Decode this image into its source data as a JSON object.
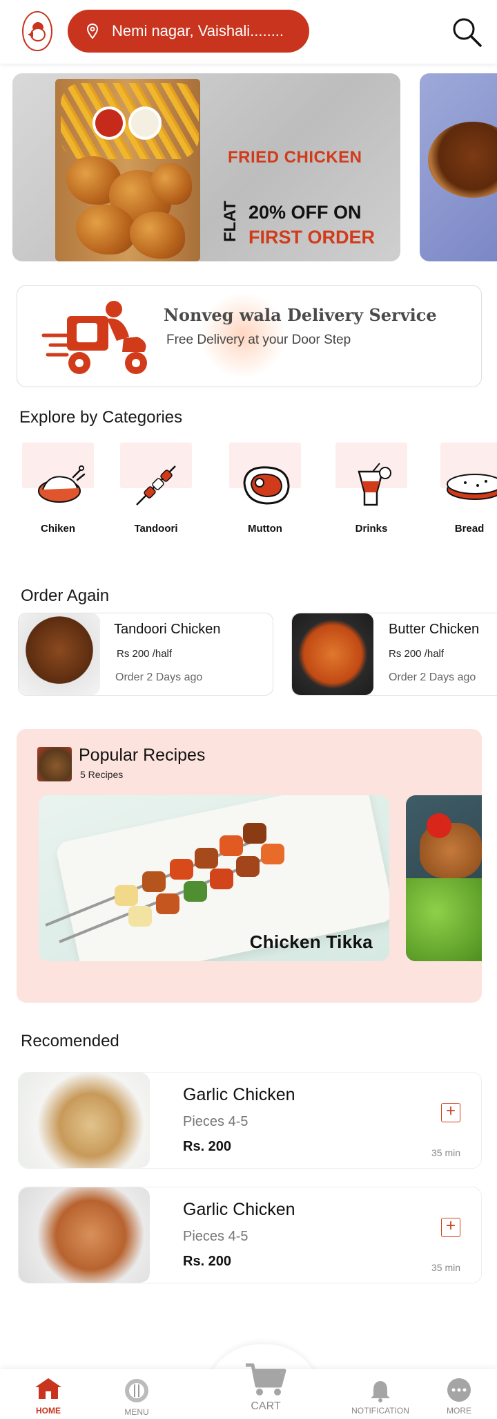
{
  "header": {
    "location": "Nemi nagar, Vaishali........"
  },
  "banner": {
    "title": "FRIED CHICKEN",
    "flat": "FLAT",
    "offer_line1": "20% OFF ON",
    "offer_line2": "FIRST ORDER"
  },
  "delivery": {
    "title": "Nonveg wala Delivery Service",
    "subtitle": "Free Delivery at your Door Step"
  },
  "categories": {
    "title": "Explore by Categories",
    "items": [
      {
        "label": "Chiken",
        "icon": "roast-chicken-icon"
      },
      {
        "label": "Tandoori",
        "icon": "skewer-icon"
      },
      {
        "label": "Mutton",
        "icon": "steak-icon"
      },
      {
        "label": "Drinks",
        "icon": "drink-glass-icon"
      },
      {
        "label": "Bread",
        "icon": "bread-icon"
      }
    ]
  },
  "order_again": {
    "title": "Order Again",
    "items": [
      {
        "name": "Tandoori Chicken",
        "price": "Rs 200 /half",
        "when": "Order 2 Days ago"
      },
      {
        "name": "Butter Chicken",
        "price": "Rs 200 /half",
        "when": "Order 2 Days ago"
      }
    ]
  },
  "popular": {
    "title": "Popular Recipes",
    "count": "5 Recipes",
    "recipes": [
      {
        "name": "Chicken Tikka"
      }
    ]
  },
  "recommended": {
    "title": "Recomended",
    "items": [
      {
        "name": "Garlic Chicken",
        "pieces": "Pieces  4-5",
        "price": "Rs. 200",
        "add": "+",
        "time": "35 min"
      },
      {
        "name": "Garlic Chicken",
        "pieces": "Pieces  4-5",
        "price": "Rs. 200",
        "add": "+",
        "time": "35 min"
      }
    ]
  },
  "nav": {
    "home": "HOME",
    "menu": "MENU",
    "cart": "CART",
    "notification": "NOTIFICATION",
    "more": "MORE"
  },
  "colors": {
    "accent": "#c8341e",
    "popular_bg": "#fde3dd",
    "category_tile": "#fdeeed"
  }
}
